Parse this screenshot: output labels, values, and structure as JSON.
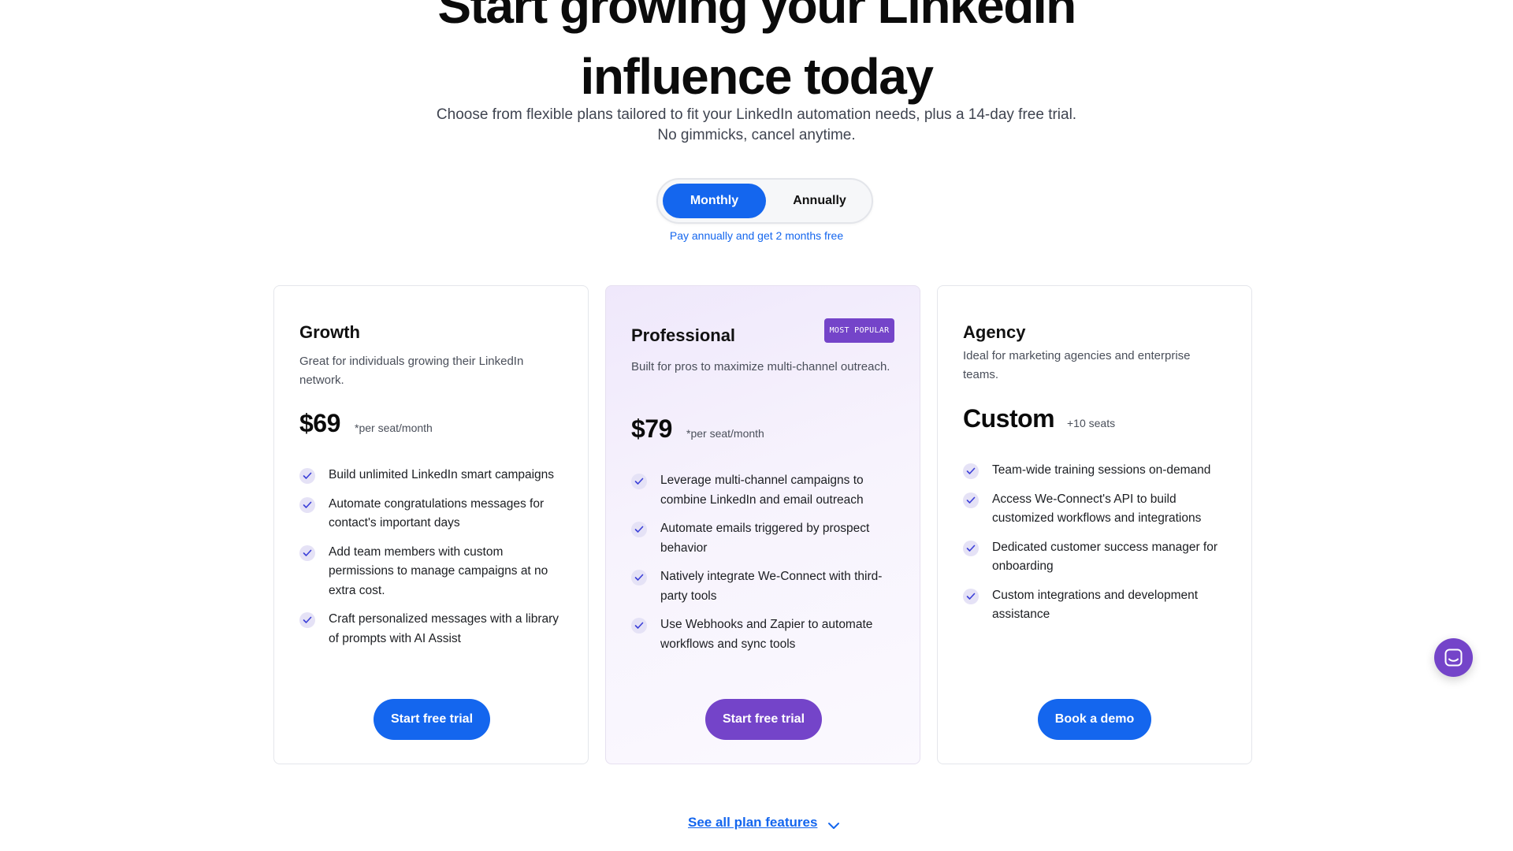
{
  "hero": {
    "title_line1": "Start growing your LinkedIn",
    "title_line2": "influence today",
    "subtitle_line1": "Choose from flexible plans tailored to fit your LinkedIn automation needs, plus a 14-day free trial.",
    "subtitle_line2": "No gimmicks, cancel anytime."
  },
  "billing_toggle": {
    "monthly": "Monthly",
    "annually": "Annually",
    "selected": "Monthly",
    "note": "Pay annually and get 2 months free"
  },
  "plans": [
    {
      "name": "Growth",
      "description": "Great for individuals growing their LinkedIn network.",
      "price": "$69",
      "price_unit": "*per seat/month",
      "features": [
        "Build unlimited LinkedIn smart campaigns",
        "Automate congratulations messages for contact's important days",
        "Add team members with custom permissions to manage campaigns at no extra cost.",
        "Craft personalized messages with a library of prompts with AI Assist"
      ],
      "cta": "Start free trial"
    },
    {
      "name": "Professional",
      "badge": "MOST POPULAR",
      "description": "Built for pros to maximize multi-channel outreach.",
      "price": "$79",
      "price_unit": "*per seat/month",
      "features": [
        "Leverage multi-channel campaigns to combine LinkedIn and email outreach",
        "Automate emails triggered by prospect behavior",
        "Natively integrate We-Connect with third-party tools",
        "Use Webhooks and Zapier to automate workflows and sync tools"
      ],
      "cta": "Start free trial"
    },
    {
      "name": "Agency",
      "description": "Ideal for marketing agencies and enterprise teams.",
      "price": "Custom",
      "price_unit": "+10 seats",
      "features": [
        "Team-wide training sessions on-demand",
        "Access We-Connect's API to build customized workflows and integrations",
        "Dedicated customer success manager for onboarding",
        "Custom integrations and development assistance"
      ],
      "cta": "Book a demo"
    }
  ],
  "see_all_link": "See all plan features",
  "colors": {
    "primary_blue": "#1466ee",
    "purple": "#7444c9",
    "check_bg": "#e5e2f6"
  },
  "icons": {
    "check": "check-icon",
    "chevron": "chevron-down-icon",
    "chat": "chat-icon"
  }
}
